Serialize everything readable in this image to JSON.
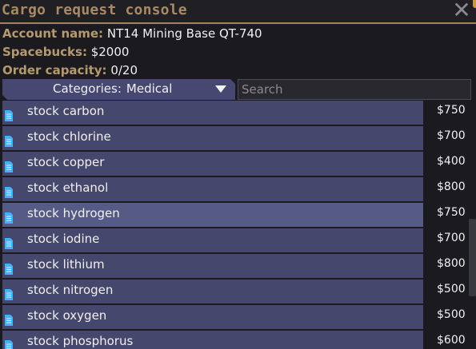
{
  "window": {
    "title": "Cargo request console",
    "close_symbol": "✕"
  },
  "account": {
    "name_label": "Account name:",
    "name_value": "NT14 Mining Base QT-740",
    "spacebucks_label": "Spacebucks:",
    "spacebucks_value": "$2000",
    "capacity_label": "Order capacity:",
    "capacity_value": "0/20"
  },
  "categories": {
    "label": "Categories:",
    "selected": "Medical"
  },
  "search": {
    "placeholder": "Search",
    "value": ""
  },
  "items": [
    {
      "name": "stock carbon",
      "price": "$750"
    },
    {
      "name": "stock chlorine",
      "price": "$700"
    },
    {
      "name": "stock copper",
      "price": "$400"
    },
    {
      "name": "stock ethanol",
      "price": "$800"
    },
    {
      "name": "stock hydrogen",
      "price": "$750"
    },
    {
      "name": "stock iodine",
      "price": "$700"
    },
    {
      "name": "stock lithium",
      "price": "$800"
    },
    {
      "name": "stock nitrogen",
      "price": "$500"
    },
    {
      "name": "stock oxygen",
      "price": "$500"
    },
    {
      "name": "stock phosphorus",
      "price": "$600"
    }
  ],
  "icons": {
    "item_icon": "document-icon",
    "dropdown": "triangle-down-icon",
    "close": "close-icon"
  },
  "colors": {
    "title": "#a88a67",
    "label": "#b59a6e",
    "item_bg": "#46476d",
    "item_highlight": "#555b85",
    "icon": "#3fb3ff"
  }
}
